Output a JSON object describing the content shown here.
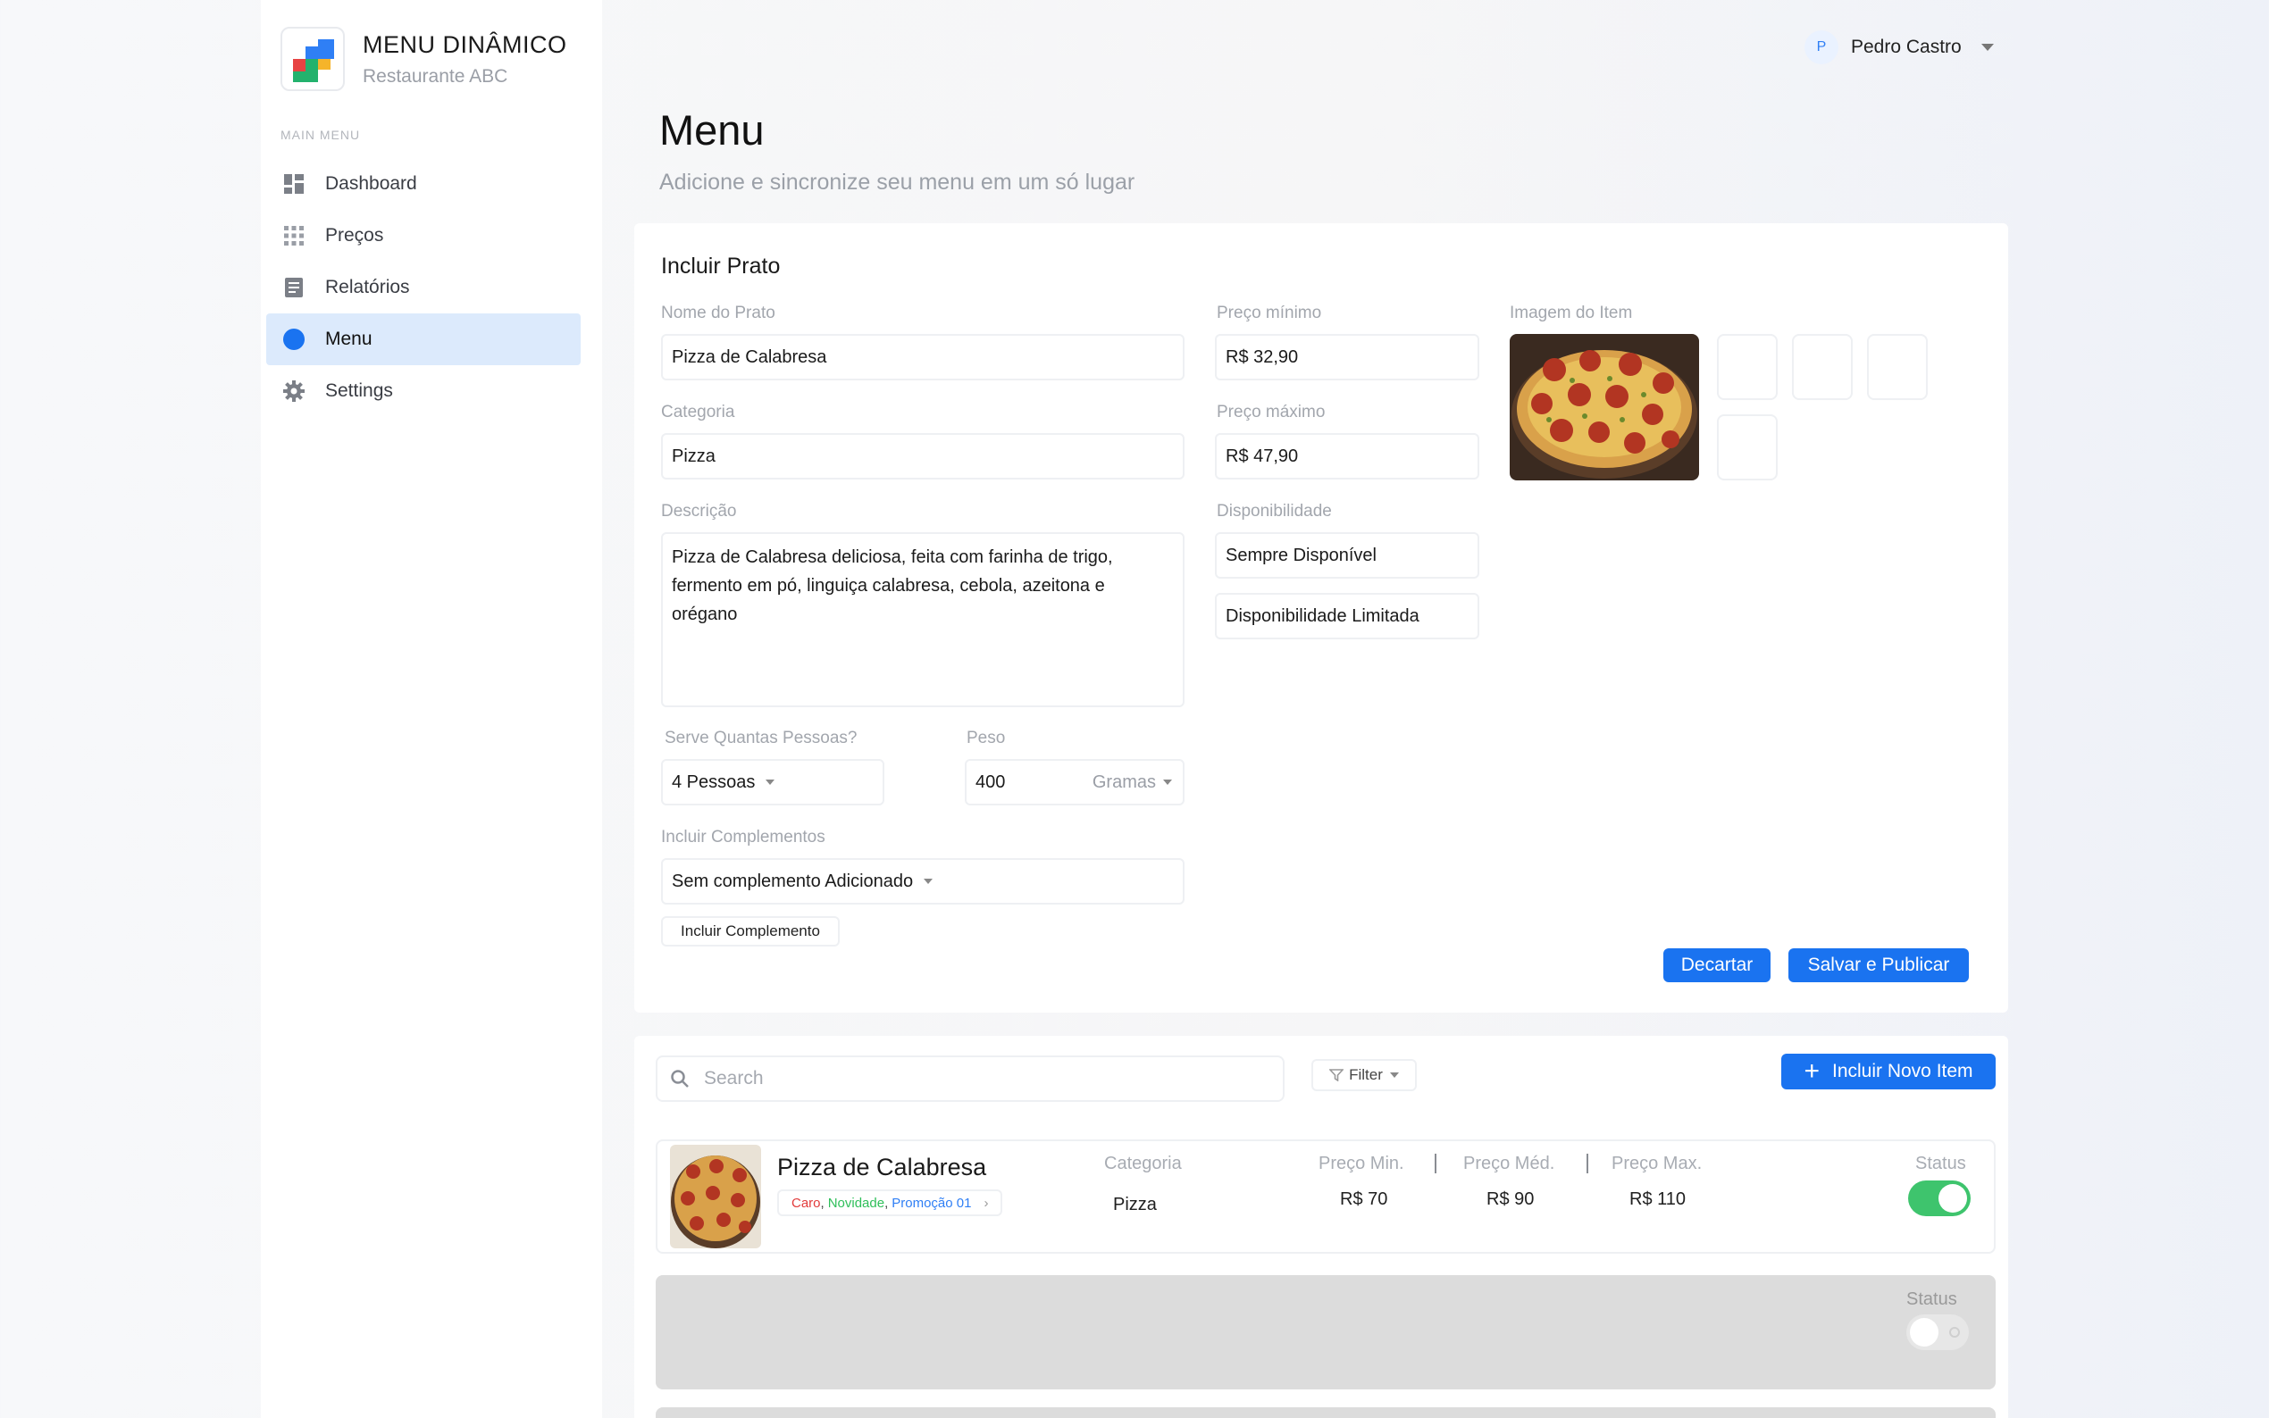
{
  "brand": {
    "title": "MENU DINÂMICO",
    "subtitle": "Restaurante ABC"
  },
  "sidebar": {
    "caption": "MAIN MENU",
    "items": [
      {
        "label": "Dashboard",
        "icon": "dashboard-icon"
      },
      {
        "label": "Preços",
        "icon": "grid-icon"
      },
      {
        "label": "Relatórios",
        "icon": "report-icon"
      },
      {
        "label": "Menu",
        "icon": "circle-icon",
        "active": true
      },
      {
        "label": "Settings",
        "icon": "gear-icon"
      }
    ]
  },
  "user": {
    "initial": "P",
    "name": "Pedro Castro"
  },
  "header": {
    "title": "Menu",
    "subtitle": "Adicione e sincronize seu menu em um só lugar"
  },
  "form": {
    "title": "Incluir Prato",
    "dish_name": {
      "label": "Nome do Prato",
      "value": "Pizza de Calabresa"
    },
    "category": {
      "label": "Categoria",
      "value": "Pizza"
    },
    "description": {
      "label": "Descrição",
      "value": "Pizza de Calabresa deliciosa, feita com farinha de trigo, fermento em pó, linguiça calabresa, cebola, azeitona e orégano"
    },
    "serves": {
      "label": "Serve Quantas Pessoas?",
      "value": "4 Pessoas"
    },
    "weight": {
      "label": "Peso",
      "value": "400",
      "unit": "Gramas"
    },
    "complements": {
      "label": "Incluir Complementos",
      "value": "Sem complemento Adicionado",
      "add_button": "Incluir Complemento"
    },
    "min_price": {
      "label": "Preço mínimo",
      "value": "R$ 32,90"
    },
    "max_price": {
      "label": "Preço máximo",
      "value": "R$ 47,90"
    },
    "availability": {
      "label": "Disponibilidade",
      "options": [
        "Sempre Disponível",
        "Disponibilidade Limitada"
      ]
    },
    "image": {
      "label": "Imagem do Item"
    },
    "discard_button": "Decartar",
    "save_button": "Salvar e Publicar"
  },
  "list": {
    "search_placeholder": "Search",
    "filter_label": "Filter",
    "add_button": "Incluir Novo Item",
    "columns": {
      "category": "Categoria",
      "min": "Preço Min.",
      "avg": "Preço Méd.",
      "max": "Preço Max.",
      "status": "Status"
    },
    "items": [
      {
        "name": "Pizza de Calabresa",
        "tags": [
          {
            "text": "Caro",
            "color": "#e23b3b"
          },
          {
            "text": "Novidade",
            "color": "#2fbf5a"
          },
          {
            "text": "Promoção 01",
            "color": "#2f7ff5"
          }
        ],
        "tag_sep": ",",
        "category": "Pizza",
        "min": "R$ 70",
        "avg": "R$ 90",
        "max": "R$ 110",
        "status": true
      }
    ],
    "placeholder_status": "Status"
  },
  "colors": {
    "accent": "#1a73f0",
    "active_nav": "#dceafc",
    "toggle_on": "#3ec46d"
  }
}
